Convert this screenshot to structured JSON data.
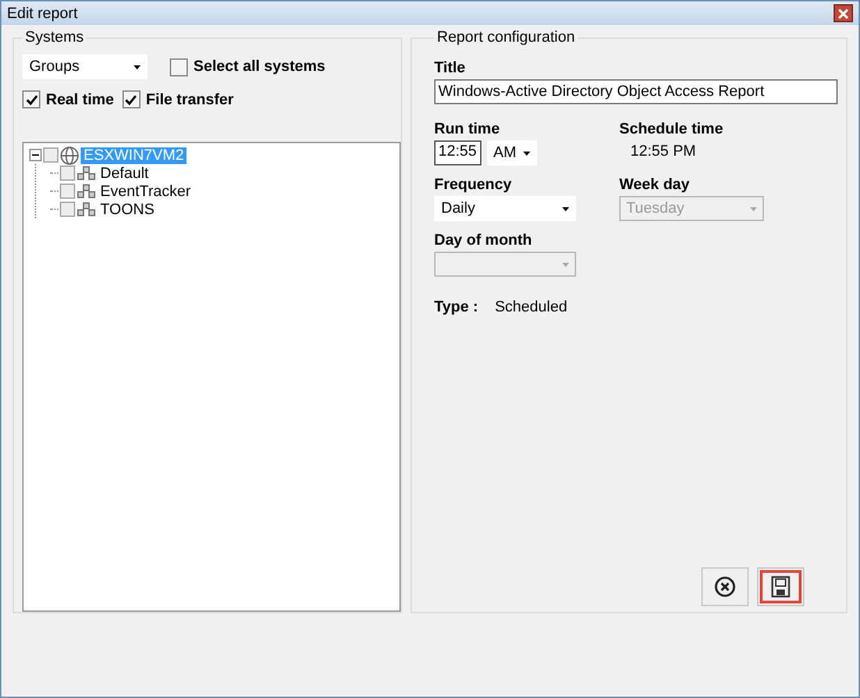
{
  "window": {
    "title": "Edit report"
  },
  "systems": {
    "legend": "Systems",
    "group_select": {
      "value": "Groups"
    },
    "select_all": {
      "label": "Select all systems",
      "checked": false
    },
    "options": [
      {
        "label": "Real time",
        "checked": true
      },
      {
        "label": "File transfer",
        "checked": true
      }
    ],
    "tree": [
      {
        "label": "ESXWIN7VM2",
        "kind": "system",
        "checked": false,
        "selected": true,
        "expanded": true,
        "children": [
          {
            "label": "Default",
            "kind": "group",
            "checked": false,
            "selected": false
          },
          {
            "label": "EventTracker",
            "kind": "group",
            "checked": false,
            "selected": false
          },
          {
            "label": "TOONS",
            "kind": "group",
            "checked": false,
            "selected": false
          }
        ]
      }
    ]
  },
  "config": {
    "legend": "Report configuration",
    "title_label": "Title",
    "title_value": "Windows-Active Directory Object Access Report",
    "run_time_label": "Run time",
    "run_time": "12:55",
    "ampm": "AM",
    "schedule_time_label": "Schedule time",
    "schedule_time": "12:55 PM",
    "frequency_label": "Frequency",
    "frequency": {
      "value": "Daily",
      "disabled": false
    },
    "week_day_label": "Week day",
    "week_day": {
      "value": "Tuesday",
      "disabled": true
    },
    "day_of_month_label": "Day of month",
    "day_of_month": {
      "disabled": true
    },
    "type_label": "Type :",
    "type_value": "Scheduled"
  },
  "buttons": [
    {
      "kind": "cancel",
      "highlighted": false
    },
    {
      "kind": "save",
      "highlighted": true
    }
  ]
}
